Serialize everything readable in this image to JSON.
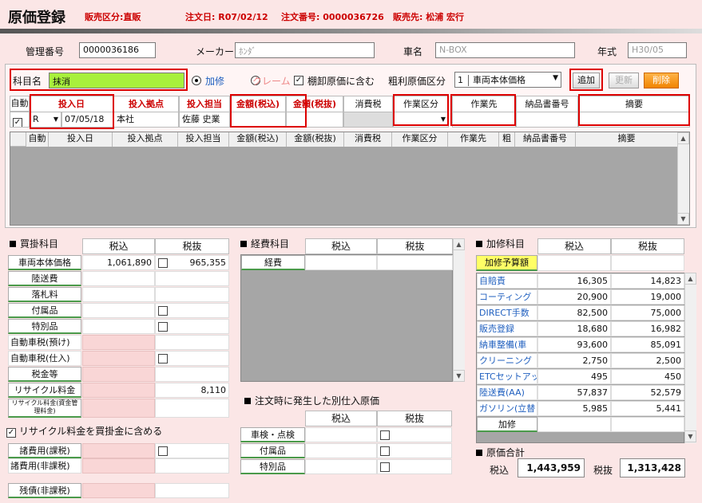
{
  "header": {
    "title": "原価登録",
    "sales_type": "販売区分:直販",
    "order_date": "注文日: R07/02/12",
    "order_no": "注文番号: 0000036726",
    "customer": "販売先: 松浦 宏行"
  },
  "top": {
    "mgmt_label": "管理番号",
    "mgmt_value": "0000036186",
    "maker_label": "メーカー",
    "maker_value": "ﾎﾝﾀﾞ",
    "car_label": "車名",
    "car_value": "N-BOX",
    "year_label": "年式",
    "year_value": "H30/05"
  },
  "form": {
    "subject_label": "科目名",
    "subject_value": "抹消",
    "radio_kashu": "加修",
    "radio_claim": "クレーム",
    "tana_label": "棚卸原価に含む",
    "arari_label": "粗利原価区分",
    "arari_num": "1",
    "arari_value": "車両本体価格",
    "add_btn": "追加",
    "update_btn": "更新",
    "delete_btn": "削除"
  },
  "entry_headers": [
    "自動",
    "投入日",
    "投入拠点",
    "投入担当",
    "金額(税込)",
    "金額(税抜)",
    "消費税",
    "作業区分",
    "作業先",
    "納品書番号",
    "摘要"
  ],
  "entry_row": {
    "era": "R",
    "date": "07/05/18",
    "base": "本社",
    "person": "佐藤 史業"
  },
  "grid_headers": [
    "自動",
    "投入日",
    "投入拠点",
    "投入担当",
    "金額(税込)",
    "金額(税抜)",
    "消費税",
    "作業区分",
    "作業先",
    "粗",
    "納品書番号",
    "摘要"
  ],
  "kaikake": {
    "title": "買掛科目",
    "col_tax_in": "税込",
    "col_tax_out": "税抜",
    "rows": [
      {
        "label": "車両本体価格",
        "in": "1,061,890",
        "chk": true,
        "out": "965,355",
        "kind": "btn"
      },
      {
        "label": "陸送費",
        "in": "",
        "chk": false,
        "out": "",
        "kind": "btn"
      },
      {
        "label": "落札料",
        "in": "",
        "chk": false,
        "out": "",
        "kind": "btn"
      },
      {
        "label": "付属品",
        "in": "",
        "chk": true,
        "out": "",
        "kind": "btn"
      },
      {
        "label": "特別品",
        "in": "",
        "chk": true,
        "out": "",
        "kind": "btn"
      },
      {
        "label": "自動車税(預け)",
        "in": "",
        "chk": false,
        "out": "",
        "kind": "lbl"
      },
      {
        "label": "自動車税(仕入)",
        "in": "",
        "chk": true,
        "out": "",
        "kind": "lbl"
      },
      {
        "label": "税金等",
        "in": "",
        "chk": false,
        "out": "",
        "kind": "btn"
      },
      {
        "label": "リサイクル料金",
        "in": "",
        "chk": false,
        "out": "8,110",
        "kind": "btn"
      },
      {
        "label": "リサイクル料金(資金管理料金)",
        "in": "",
        "chk": false,
        "out": "",
        "kind": "btn"
      }
    ],
    "recycle_check": "リサイクル料金を買掛金に含める",
    "misc1": "諸費用(課税)",
    "misc2": "諸費用(非課税)",
    "zansai": "残債(非課税)"
  },
  "keihi": {
    "title": "経費科目",
    "col_tax_in": "税込",
    "col_tax_out": "税抜",
    "row1": "経費"
  },
  "betsu": {
    "title": "注文時に発生した別仕入原価",
    "col_tax_in": "税込",
    "col_tax_out": "税抜",
    "rows": [
      "車検・点検",
      "付属品",
      "特別品"
    ]
  },
  "kashu": {
    "title": "加修科目",
    "col_tax_in": "税込",
    "col_tax_out": "税抜",
    "budget": "加修予算額",
    "rows": [
      {
        "label": "自賠責",
        "in": "16,305",
        "out": "14,823"
      },
      {
        "label": "コーティング",
        "in": "20,900",
        "out": "19,000"
      },
      {
        "label": "DIRECT手数",
        "in": "82,500",
        "out": "75,000"
      },
      {
        "label": "販売登録",
        "in": "18,680",
        "out": "16,982"
      },
      {
        "label": "納車整備(車",
        "in": "93,600",
        "out": "85,091"
      },
      {
        "label": "クリーニング",
        "in": "2,750",
        "out": "2,500"
      },
      {
        "label": "ETCセットアッ",
        "in": "495",
        "out": "450"
      },
      {
        "label": "陸送費(AA)",
        "in": "57,837",
        "out": "52,579"
      },
      {
        "label": "ガソリン(立替",
        "in": "5,985",
        "out": "5,441"
      }
    ],
    "kashu_btn": "加修"
  },
  "total": {
    "title": "原価合計",
    "in_label": "税込",
    "in_value": "1,443,959",
    "out_label": "税抜",
    "out_value": "1,313,428"
  },
  "colors": {
    "bg": "#fbe6e6",
    "red": "#cc0000",
    "green": "#a8f03c",
    "link": "#1f5fbf"
  }
}
